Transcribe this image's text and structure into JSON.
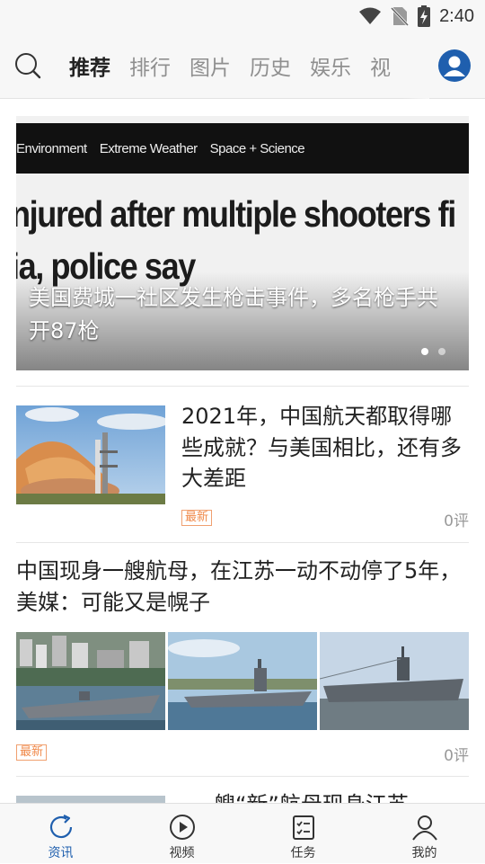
{
  "status_bar": {
    "time": "2:40",
    "icons": [
      "wifi-icon",
      "no-sim-icon",
      "battery-charging-icon"
    ]
  },
  "top_nav": {
    "search_icon": "search-icon",
    "tabs": [
      {
        "label": "推荐",
        "active": true
      },
      {
        "label": "排行",
        "active": false
      },
      {
        "label": "图片",
        "active": false
      },
      {
        "label": "历史",
        "active": false
      },
      {
        "label": "娱乐",
        "active": false
      },
      {
        "label": "视",
        "active": false
      }
    ],
    "profile_icon": "user-avatar-icon"
  },
  "banner": {
    "image_nav_items": [
      "Environment",
      "Extreme Weather",
      "Space + Science"
    ],
    "image_headline_lines": [
      "njured after multiple shooters fi",
      "ia, police say"
    ],
    "caption": "美国费城一社区发生枪击事件，多名枪手共开87枪",
    "slide_count": 2,
    "active_slide": 1
  },
  "articles": [
    {
      "title": "2021年，中国航天都取得哪些成就？与美国相比，还有多大差距",
      "tag": "最新",
      "comments": "0评"
    },
    {
      "title": "中国现身一艘航母，在江苏一动不动停了5年，美媒：可能又是幌子",
      "tag": "最新",
      "comments": "0评"
    },
    {
      "title": "一艘“新”航母现身江苏"
    }
  ],
  "bottom_nav": {
    "items": [
      {
        "label": "资讯",
        "icon": "refresh-circle-icon",
        "active": true
      },
      {
        "label": "视频",
        "icon": "play-circle-icon",
        "active": false
      },
      {
        "label": "任务",
        "icon": "task-list-icon",
        "active": false
      },
      {
        "label": "我的",
        "icon": "person-icon",
        "active": false
      }
    ]
  },
  "colors": {
    "accent": "#1f5fae",
    "tag": "#f08a4b",
    "muted_text": "#999999"
  }
}
